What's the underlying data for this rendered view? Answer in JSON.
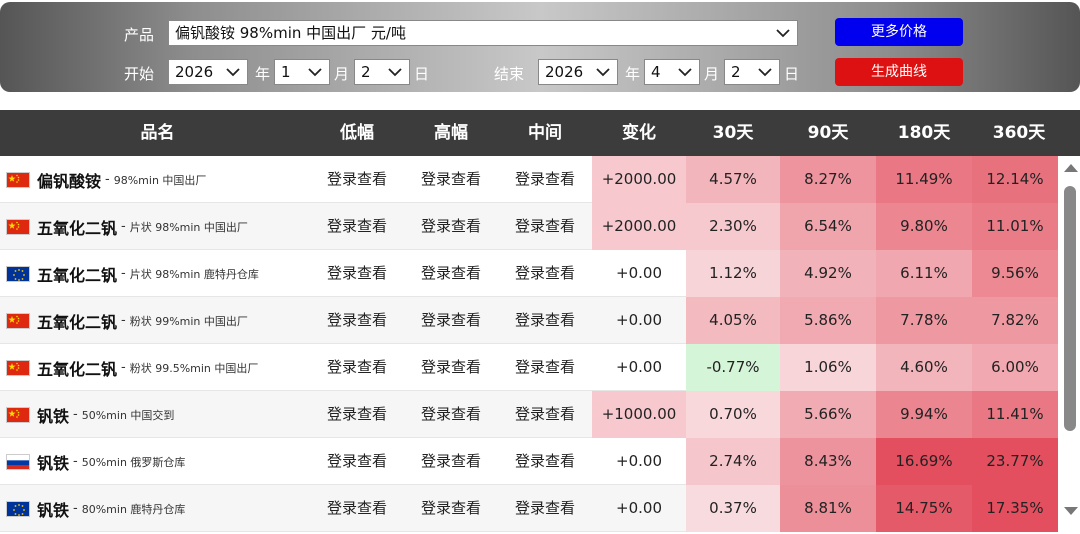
{
  "controls": {
    "product_label": "产品",
    "product_value": "偏钒酸铵 98%min 中国出厂 元/吨",
    "start_label": "开始",
    "end_label": "结束",
    "start_year": "2026",
    "start_month": "1",
    "start_day": "2",
    "end_year": "2026",
    "end_month": "4",
    "end_day": "2",
    "year_unit": "年",
    "month_unit": "月",
    "day_unit": "日",
    "more_prices_label": "更多价格",
    "generate_curve_label": "生成曲线",
    "blue_button_color": "#0000ee",
    "red_button_color": "#dd1111"
  },
  "table": {
    "headers": [
      "品名",
      "低幅",
      "高幅",
      "中间",
      "变化",
      "30天",
      "90天",
      "180天",
      "360天"
    ],
    "rows": [
      {
        "flag": "china",
        "name": "偏钒酸铵",
        "spec": "98%min 中国出厂",
        "low": "登录查看",
        "high": "登录查看",
        "mid": "登录查看",
        "change": "+2000.00",
        "d30": "4.57%",
        "d90": "8.27%",
        "d180": "11.49%",
        "d360": "12.14%"
      },
      {
        "flag": "china",
        "name": "五氧化二钒",
        "spec": "片状 98%min 中国出厂",
        "low": "登录查看",
        "high": "登录查看",
        "mid": "登录查看",
        "change": "+2000.00",
        "d30": "2.30%",
        "d90": "6.54%",
        "d180": "9.80%",
        "d360": "11.01%"
      },
      {
        "flag": "eu",
        "name": "五氧化二钒",
        "spec": "片状 98%min 鹿特丹仓库",
        "low": "登录查看",
        "high": "登录查看",
        "mid": "登录查看",
        "change": "+0.00",
        "d30": "1.12%",
        "d90": "4.92%",
        "d180": "6.11%",
        "d360": "9.56%"
      },
      {
        "flag": "china",
        "name": "五氧化二钒",
        "spec": "粉状 99%min 中国出厂",
        "low": "登录查看",
        "high": "登录查看",
        "mid": "登录查看",
        "change": "+0.00",
        "d30": "4.05%",
        "d90": "5.86%",
        "d180": "7.78%",
        "d360": "7.82%"
      },
      {
        "flag": "china",
        "name": "五氧化二钒",
        "spec": "粉状 99.5%min 中国出厂",
        "low": "登录查看",
        "high": "登录查看",
        "mid": "登录查看",
        "change": "+0.00",
        "d30": "-0.77%",
        "d90": "1.06%",
        "d180": "4.60%",
        "d360": "6.00%"
      },
      {
        "flag": "china",
        "name": "钒铁",
        "spec": "50%min 中国交到",
        "low": "登录查看",
        "high": "登录查看",
        "mid": "登录查看",
        "change": "+1000.00",
        "d30": "0.70%",
        "d90": "5.66%",
        "d180": "9.94%",
        "d360": "11.41%"
      },
      {
        "flag": "russia",
        "name": "钒铁",
        "spec": "50%min 俄罗斯仓库",
        "low": "登录查看",
        "high": "登录查看",
        "mid": "登录查看",
        "change": "+0.00",
        "d30": "2.74%",
        "d90": "8.43%",
        "d180": "16.69%",
        "d360": "23.77%"
      },
      {
        "flag": "eu",
        "name": "钒铁",
        "spec": "80%min 鹿特丹仓库",
        "low": "登录查看",
        "high": "登录查看",
        "mid": "登录查看",
        "change": "+0.00",
        "d30": "0.37%",
        "d90": "8.81%",
        "d180": "14.75%",
        "d360": "17.35%"
      }
    ]
  },
  "colors": {
    "header_bg": "#3c3c3c",
    "positive_light": "#f8d3d7",
    "positive_strong": "#e34f5f",
    "negative_light": "#d5f5d9"
  }
}
